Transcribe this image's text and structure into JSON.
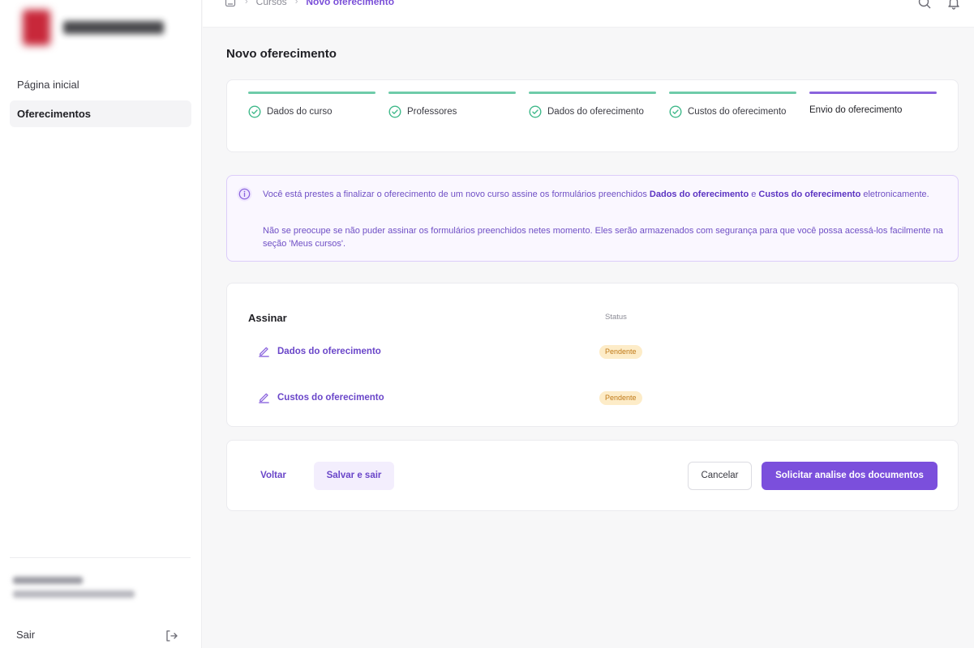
{
  "sidebar": {
    "logo_icon": "brand-logo",
    "items": [
      {
        "label": "Página inicial",
        "active": false
      },
      {
        "label": "Oferecimentos",
        "active": true
      }
    ],
    "logout_label": "Sair",
    "logout_icon": "logout-icon"
  },
  "topbar": {
    "breadcrumbs": [
      "Cursos",
      "Novo oferecimento"
    ],
    "home_icon": "home-icon",
    "icons": [
      "search-icon",
      "bell-icon"
    ]
  },
  "page": {
    "title": "Novo oferecimento"
  },
  "stepper": {
    "steps": [
      {
        "label": "Dados do curso",
        "state": "done"
      },
      {
        "label": "Professores",
        "state": "done"
      },
      {
        "label": "Dados do oferecimento",
        "state": "done"
      },
      {
        "label": "Custos do oferecimento",
        "state": "done"
      },
      {
        "label": "Envio do oferecimento",
        "state": "current"
      }
    ]
  },
  "alert": {
    "icon": "info-icon",
    "p1_pre": "Você está prestes a finalizar o oferecimento de um novo curso assine os formulários preenchidos ",
    "p1_b1": "Dados do oferecimento",
    "p1_mid": " e ",
    "p1_b2": "Custos do oferecimento",
    "p1_post": " eletronicamente.",
    "p2": "Não se preocupe se não puder assinar os formulários preenchidos netes momento. Eles serão armazenados com segurança para que você possa acessá-los facilmente na seção 'Meus cursos'."
  },
  "sign": {
    "header": "Assinar",
    "status_header": "Status",
    "rows": [
      {
        "label": "Dados do oferecimento",
        "status": "Pendente"
      },
      {
        "label": "Custos do oferecimento",
        "status": "Pendente"
      }
    ]
  },
  "actions": {
    "back": "Voltar",
    "save": "Salvar e sair",
    "cancel": "Cancelar",
    "submit": "Solicitar analise dos documentos"
  },
  "colors": {
    "accent": "#7b4fdc",
    "step_done": "#6ecba9",
    "pending_bg": "#fdecc8",
    "pending_text": "#c07a19"
  }
}
